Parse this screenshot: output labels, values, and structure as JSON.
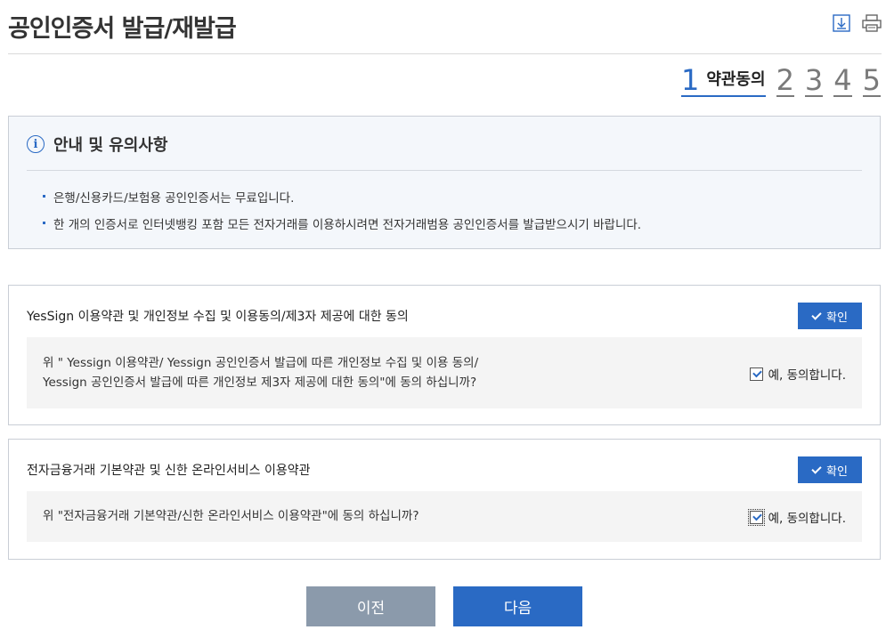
{
  "header": {
    "title": "공인인증서 발급/재발급",
    "icons": [
      "save-icon",
      "print-icon"
    ]
  },
  "steps": {
    "active_number": "1",
    "active_label": "약관동의",
    "others": [
      "2",
      "3",
      "4",
      "5"
    ]
  },
  "notice": {
    "title": "안내 및 유의사항",
    "items": [
      "은행/신용카드/보험용 공인인증서는 무료입니다.",
      "한 개의 인증서로 인터넷뱅킹 포함 모든 전자거래를 이용하시려면 전자거래범용 공인인증서를 발급받으시기 바랍니다."
    ]
  },
  "agreements": [
    {
      "title": "YesSign 이용약관 및 개인정보 수집 및 이용동의/제3자 제공에 대한 동의",
      "button": "확인",
      "question_line1": "위 \" Yessign 이용약관/ Yessign 공인인증서 발급에 따른 개인정보 수집 및 이용 동의/",
      "question_line2": "Yessign 공인인증서 발급에 따른 개인정보 제3자 제공에 대한 동의\"에 동의 하십니까?",
      "check_label": "예, 동의합니다.",
      "checked": true
    },
    {
      "title": "전자금융거래 기본약관 및 신한 온라인서비스 이용약관",
      "button": "확인",
      "question_line1": "위 \"전자금융거래 기본약관/신한 온라인서비스 이용약관\"에 동의 하십니까?",
      "check_label": "예, 동의합니다.",
      "checked": true
    }
  ],
  "nav": {
    "prev": "이전",
    "next": "다음"
  },
  "colors": {
    "accent": "#2a6ac4",
    "prev_button": "#8b9aab",
    "notice_bg": "#f4f7fb"
  }
}
